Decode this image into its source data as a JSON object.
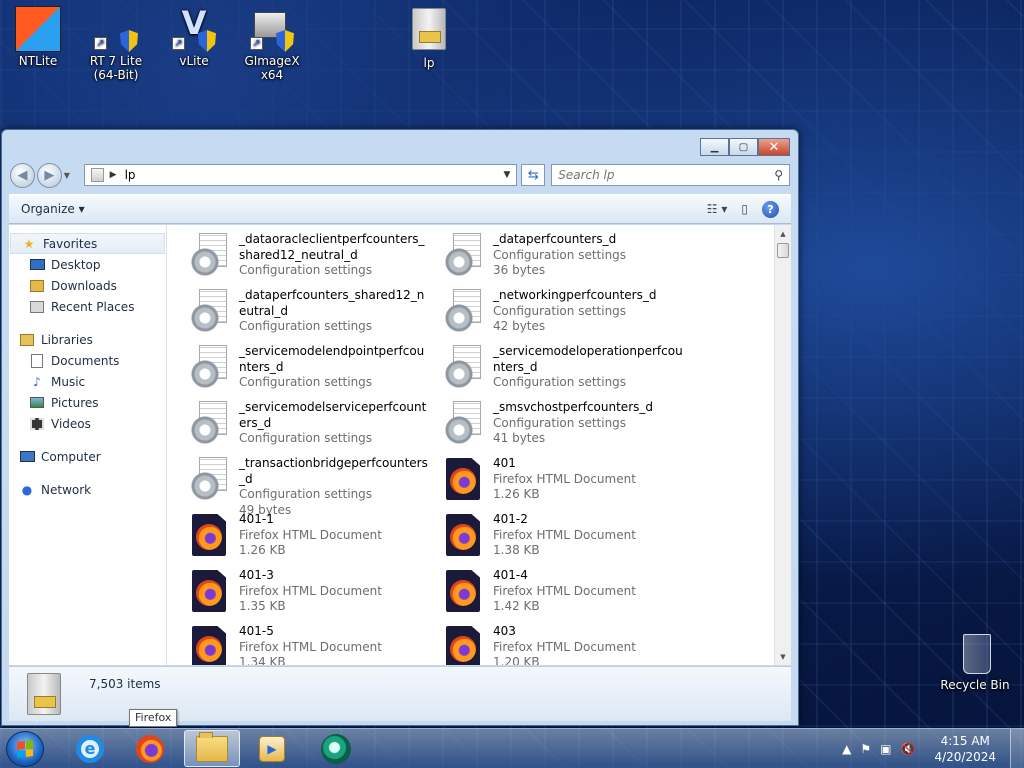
{
  "desktop": {
    "icons": [
      {
        "label": "NTLite",
        "icon": "ntlite-icon"
      },
      {
        "label": "RT 7 Lite (64-Bit)",
        "icon": "rt7lite-icon"
      },
      {
        "label": "vLite",
        "icon": "vlite-icon"
      },
      {
        "label": "GImageX x64",
        "icon": "gimagex-icon"
      },
      {
        "label": "lp",
        "icon": "server-icon"
      },
      {
        "label": "Recycle Bin",
        "icon": "recycle-bin-icon"
      }
    ]
  },
  "window": {
    "caption": {
      "minimize": "▁",
      "maximize": "▢",
      "close": "✕"
    },
    "address": {
      "path": "lp"
    },
    "search": {
      "placeholder": "Search lp"
    },
    "toolbar": {
      "organize": "Organize ▾"
    },
    "nav": {
      "favorites": "Favorites",
      "favorites_items": [
        "Desktop",
        "Downloads",
        "Recent Places"
      ],
      "libraries": "Libraries",
      "libraries_items": [
        "Documents",
        "Music",
        "Pictures",
        "Videos"
      ],
      "computer": "Computer",
      "network": "Network"
    },
    "files": [
      {
        "name": "_dataoracleclientperfcounters_shared12_neutral_d",
        "meta": "Configuration settings",
        "icon": "config-file-icon"
      },
      {
        "name": "_dataperfcounters_d",
        "meta": "Configuration settings",
        "size": "36 bytes",
        "icon": "config-file-icon"
      },
      {
        "name": "_dataperfcounters_shared12_neutral_d",
        "meta": "Configuration settings",
        "icon": "config-file-icon"
      },
      {
        "name": "_networkingperfcounters_d",
        "meta": "Configuration settings",
        "size": "42 bytes",
        "icon": "config-file-icon"
      },
      {
        "name": "_servicemodelendpointperfcounters_d",
        "meta": "Configuration settings",
        "icon": "config-file-icon"
      },
      {
        "name": "_servicemodeloperationperfcounters_d",
        "meta": "Configuration settings",
        "icon": "config-file-icon"
      },
      {
        "name": "_servicemodelserviceperfcounters_d",
        "meta": "Configuration settings",
        "icon": "config-file-icon"
      },
      {
        "name": "_smsvchostperfcounters_d",
        "meta": "Configuration settings",
        "size": "41 bytes",
        "icon": "config-file-icon"
      },
      {
        "name": "_transactionbridgeperfcounters_d",
        "meta": "Configuration settings",
        "size": "49 bytes",
        "icon": "config-file-icon"
      },
      {
        "name": "401",
        "meta": "Firefox HTML Document",
        "size": "1.26 KB",
        "icon": "firefox-html-icon"
      },
      {
        "name": "401-1",
        "meta": "Firefox HTML Document",
        "size": "1.26 KB",
        "icon": "firefox-html-icon"
      },
      {
        "name": "401-2",
        "meta": "Firefox HTML Document",
        "size": "1.38 KB",
        "icon": "firefox-html-icon"
      },
      {
        "name": "401-3",
        "meta": "Firefox HTML Document",
        "size": "1.35 KB",
        "icon": "firefox-html-icon"
      },
      {
        "name": "401-4",
        "meta": "Firefox HTML Document",
        "size": "1.42 KB",
        "icon": "firefox-html-icon"
      },
      {
        "name": "401-5",
        "meta": "Firefox HTML Document",
        "size": "1.34 KB",
        "icon": "firefox-html-icon"
      },
      {
        "name": "403",
        "meta": "Firefox HTML Document",
        "size": "1.20 KB",
        "icon": "firefox-html-icon"
      }
    ],
    "status": {
      "item_count": "7,503 items"
    }
  },
  "tooltip": "Firefox",
  "taskbar": {
    "apps": [
      "internet-explorer-icon",
      "firefox-icon",
      "windows-explorer-icon",
      "media-player-icon",
      "green-app-icon"
    ],
    "tray": {
      "time": "4:15 AM",
      "date": "4/20/2024"
    }
  }
}
